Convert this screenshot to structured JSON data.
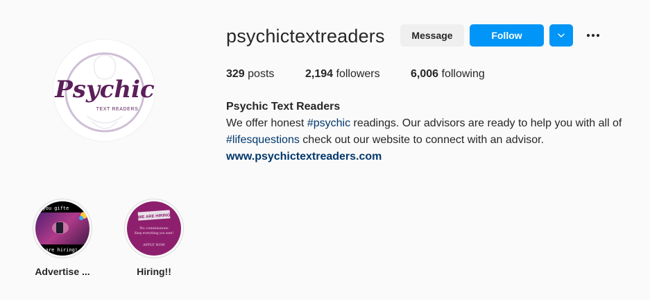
{
  "profile": {
    "username": "psychictextreaders",
    "logo_text": "Psychic",
    "logo_subtext": "TEXT READERS"
  },
  "actions": {
    "message_label": "Message",
    "follow_label": "Follow",
    "dropdown_icon": "chevron-down-icon",
    "more_icon": "more-options-icon"
  },
  "stats": {
    "posts_count": "329",
    "posts_label": "posts",
    "followers_count": "2,194",
    "followers_label": "followers",
    "following_count": "6,006",
    "following_label": "following"
  },
  "bio": {
    "name": "Psychic Text Readers",
    "line1_a": "We offer honest ",
    "hashtag1": "#psychic",
    "line1_b": " readings. Our advisors are ready to help you with all of",
    "hashtag2": "#lifesquestions",
    "line2_b": " check out our website to connect with an advisor.",
    "website": "www.psychictextreaders.com"
  },
  "highlights": [
    {
      "label": "Advertise ...",
      "img_top": "e you gifte",
      "img_bottom": "we are hiring!"
    },
    {
      "label": "Hiring!!",
      "img_top": "WE ARE HIRING",
      "img_mid1": "No commissions",
      "img_mid2": "Keep everything you earn!",
      "img_bottom": "APPLY NOW"
    }
  ],
  "colors": {
    "follow_button": "#0095f6",
    "link": "#00376b",
    "logo_purple": "#5b1f5a",
    "logo_ring": "#cdbfd5"
  }
}
